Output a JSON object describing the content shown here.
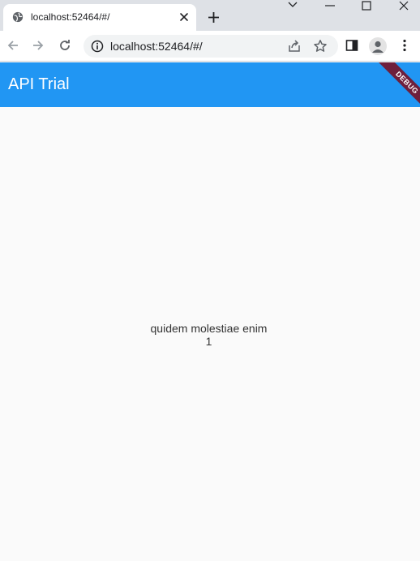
{
  "browser": {
    "tab": {
      "title": "localhost:52464/#/",
      "favicon": "globe-icon"
    },
    "url": "localhost:52464/#/",
    "colors": {
      "tabstrip": "#dee1e6",
      "toolbar": "#ffffff",
      "omnibox": "#f1f3f4"
    }
  },
  "app": {
    "title": "API Trial",
    "debug_banner": "DEBUG",
    "colors": {
      "appbar": "#2196f3",
      "background": "#fafafa",
      "debug_banner": "#6e1f3c"
    },
    "content": {
      "item_title": "quidem molestiae enim",
      "item_id": "1"
    }
  }
}
